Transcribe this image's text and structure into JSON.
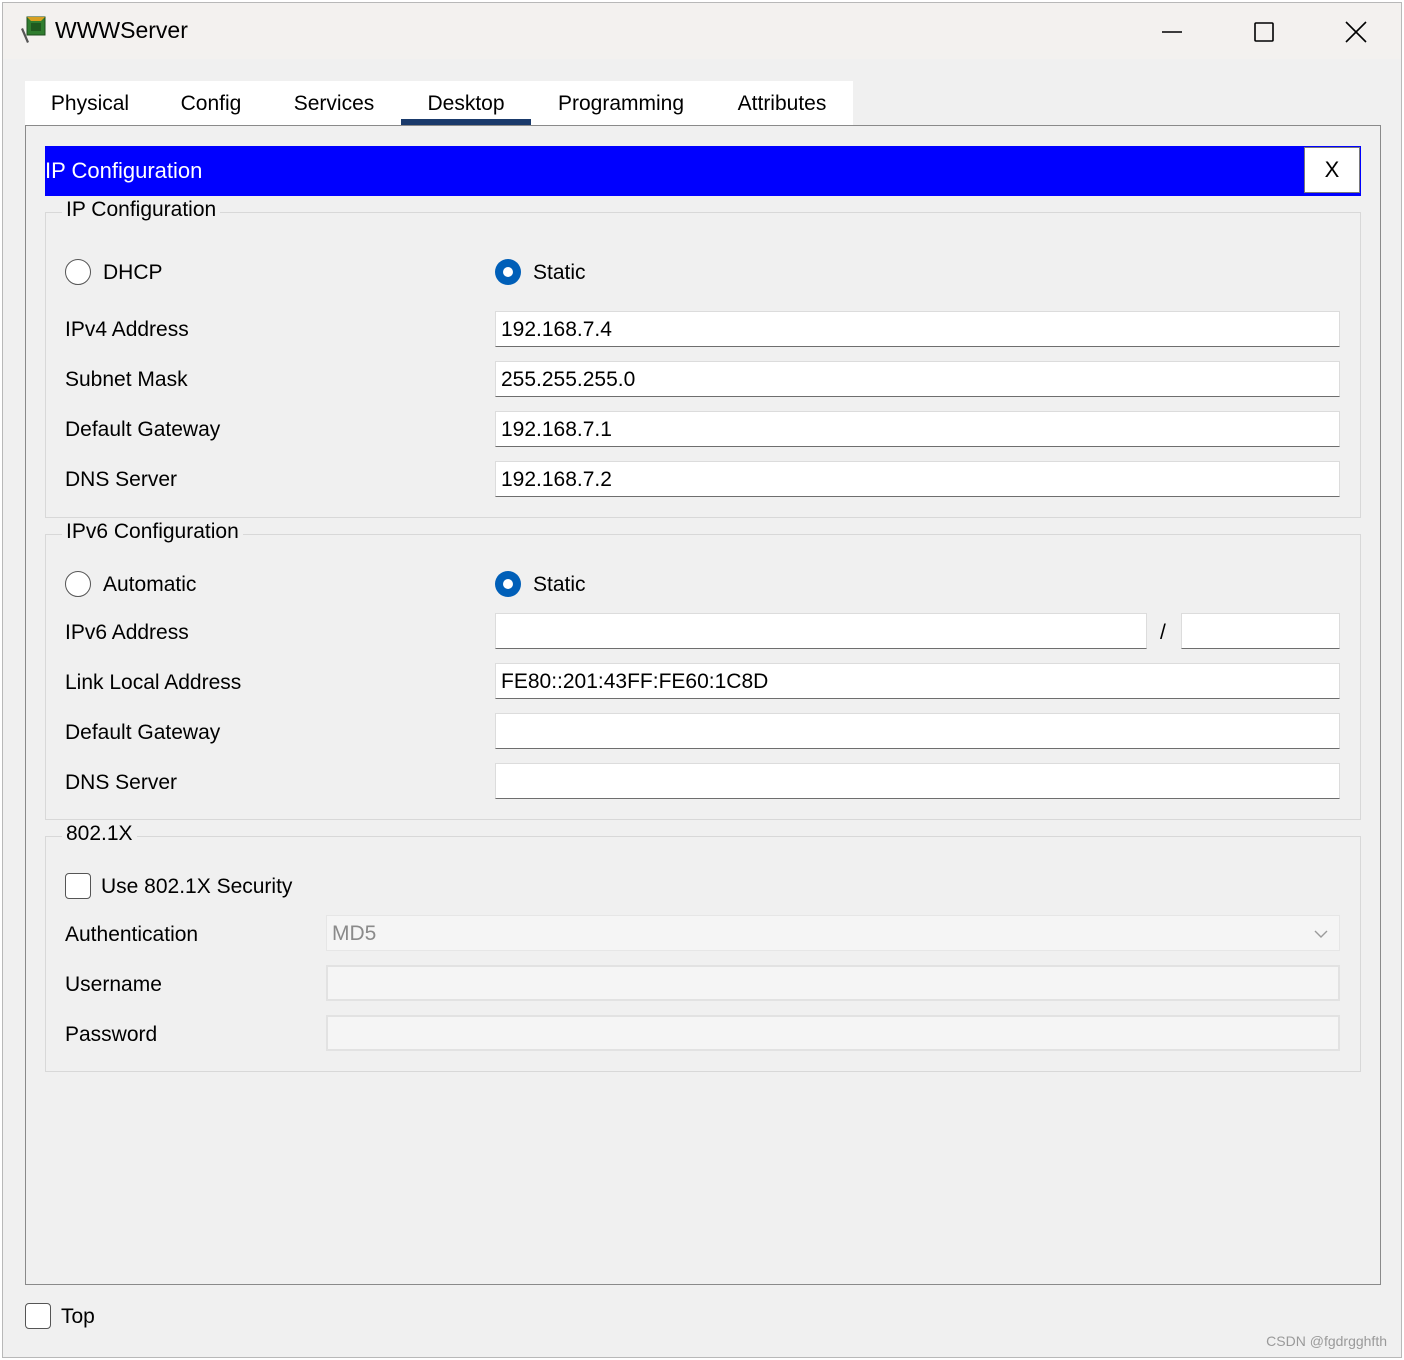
{
  "window": {
    "title": "WWWServer"
  },
  "tabs": [
    "Physical",
    "Config",
    "Services",
    "Desktop",
    "Programming",
    "Attributes"
  ],
  "active_tab": "Desktop",
  "panel": {
    "title": "IP Configuration",
    "close_label": "X"
  },
  "ipv4": {
    "legend": "IP Configuration",
    "dhcp_label": "DHCP",
    "static_label": "Static",
    "mode": "Static",
    "ipv4_address_label": "IPv4 Address",
    "ipv4_address": "192.168.7.4",
    "subnet_mask_label": "Subnet Mask",
    "subnet_mask": "255.255.255.0",
    "gateway_label": "Default Gateway",
    "gateway": "192.168.7.1",
    "dns_label": "DNS Server",
    "dns": "192.168.7.2"
  },
  "ipv6": {
    "legend": "IPv6 Configuration",
    "automatic_label": "Automatic",
    "static_label": "Static",
    "mode": "Static",
    "address_label": "IPv6 Address",
    "address": "",
    "prefix_separator": "/",
    "prefix": "",
    "link_local_label": "Link Local Address",
    "link_local": "FE80::201:43FF:FE60:1C8D",
    "gateway_label": "Default Gateway",
    "gateway": "",
    "dns_label": "DNS Server",
    "dns": ""
  },
  "dot1x": {
    "legend": "802.1X",
    "use_security_label": "Use 802.1X Security",
    "use_security": false,
    "authentication_label": "Authentication",
    "authentication": "MD5",
    "username_label": "Username",
    "username": "",
    "password_label": "Password",
    "password": ""
  },
  "footer": {
    "top_label": "Top",
    "top_checked": false
  },
  "watermark": "CSDN @fgdrgghfth",
  "colors": {
    "header_blue": "#0000ff",
    "radio_selected": "#005fb8",
    "tab_underline": "#1a3a6b"
  }
}
